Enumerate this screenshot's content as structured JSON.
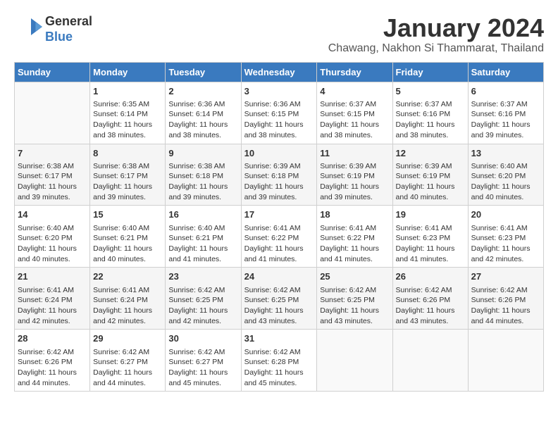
{
  "header": {
    "logo_line1": "General",
    "logo_line2": "Blue",
    "month_title": "January 2024",
    "subtitle": "Chawang, Nakhon Si Thammarat, Thailand"
  },
  "weekdays": [
    "Sunday",
    "Monday",
    "Tuesday",
    "Wednesday",
    "Thursday",
    "Friday",
    "Saturday"
  ],
  "weeks": [
    [
      {
        "day": "",
        "info": ""
      },
      {
        "day": "1",
        "info": "Sunrise: 6:35 AM\nSunset: 6:14 PM\nDaylight: 11 hours and 38 minutes."
      },
      {
        "day": "2",
        "info": "Sunrise: 6:36 AM\nSunset: 6:14 PM\nDaylight: 11 hours and 38 minutes."
      },
      {
        "day": "3",
        "info": "Sunrise: 6:36 AM\nSunset: 6:15 PM\nDaylight: 11 hours and 38 minutes."
      },
      {
        "day": "4",
        "info": "Sunrise: 6:37 AM\nSunset: 6:15 PM\nDaylight: 11 hours and 38 minutes."
      },
      {
        "day": "5",
        "info": "Sunrise: 6:37 AM\nSunset: 6:16 PM\nDaylight: 11 hours and 38 minutes."
      },
      {
        "day": "6",
        "info": "Sunrise: 6:37 AM\nSunset: 6:16 PM\nDaylight: 11 hours and 39 minutes."
      }
    ],
    [
      {
        "day": "7",
        "info": "Sunrise: 6:38 AM\nSunset: 6:17 PM\nDaylight: 11 hours and 39 minutes."
      },
      {
        "day": "8",
        "info": "Sunrise: 6:38 AM\nSunset: 6:17 PM\nDaylight: 11 hours and 39 minutes."
      },
      {
        "day": "9",
        "info": "Sunrise: 6:38 AM\nSunset: 6:18 PM\nDaylight: 11 hours and 39 minutes."
      },
      {
        "day": "10",
        "info": "Sunrise: 6:39 AM\nSunset: 6:18 PM\nDaylight: 11 hours and 39 minutes."
      },
      {
        "day": "11",
        "info": "Sunrise: 6:39 AM\nSunset: 6:19 PM\nDaylight: 11 hours and 39 minutes."
      },
      {
        "day": "12",
        "info": "Sunrise: 6:39 AM\nSunset: 6:19 PM\nDaylight: 11 hours and 40 minutes."
      },
      {
        "day": "13",
        "info": "Sunrise: 6:40 AM\nSunset: 6:20 PM\nDaylight: 11 hours and 40 minutes."
      }
    ],
    [
      {
        "day": "14",
        "info": "Sunrise: 6:40 AM\nSunset: 6:20 PM\nDaylight: 11 hours and 40 minutes."
      },
      {
        "day": "15",
        "info": "Sunrise: 6:40 AM\nSunset: 6:21 PM\nDaylight: 11 hours and 40 minutes."
      },
      {
        "day": "16",
        "info": "Sunrise: 6:40 AM\nSunset: 6:21 PM\nDaylight: 11 hours and 41 minutes."
      },
      {
        "day": "17",
        "info": "Sunrise: 6:41 AM\nSunset: 6:22 PM\nDaylight: 11 hours and 41 minutes."
      },
      {
        "day": "18",
        "info": "Sunrise: 6:41 AM\nSunset: 6:22 PM\nDaylight: 11 hours and 41 minutes."
      },
      {
        "day": "19",
        "info": "Sunrise: 6:41 AM\nSunset: 6:23 PM\nDaylight: 11 hours and 41 minutes."
      },
      {
        "day": "20",
        "info": "Sunrise: 6:41 AM\nSunset: 6:23 PM\nDaylight: 11 hours and 42 minutes."
      }
    ],
    [
      {
        "day": "21",
        "info": "Sunrise: 6:41 AM\nSunset: 6:24 PM\nDaylight: 11 hours and 42 minutes."
      },
      {
        "day": "22",
        "info": "Sunrise: 6:41 AM\nSunset: 6:24 PM\nDaylight: 11 hours and 42 minutes."
      },
      {
        "day": "23",
        "info": "Sunrise: 6:42 AM\nSunset: 6:25 PM\nDaylight: 11 hours and 42 minutes."
      },
      {
        "day": "24",
        "info": "Sunrise: 6:42 AM\nSunset: 6:25 PM\nDaylight: 11 hours and 43 minutes."
      },
      {
        "day": "25",
        "info": "Sunrise: 6:42 AM\nSunset: 6:25 PM\nDaylight: 11 hours and 43 minutes."
      },
      {
        "day": "26",
        "info": "Sunrise: 6:42 AM\nSunset: 6:26 PM\nDaylight: 11 hours and 43 minutes."
      },
      {
        "day": "27",
        "info": "Sunrise: 6:42 AM\nSunset: 6:26 PM\nDaylight: 11 hours and 44 minutes."
      }
    ],
    [
      {
        "day": "28",
        "info": "Sunrise: 6:42 AM\nSunset: 6:26 PM\nDaylight: 11 hours and 44 minutes."
      },
      {
        "day": "29",
        "info": "Sunrise: 6:42 AM\nSunset: 6:27 PM\nDaylight: 11 hours and 44 minutes."
      },
      {
        "day": "30",
        "info": "Sunrise: 6:42 AM\nSunset: 6:27 PM\nDaylight: 11 hours and 45 minutes."
      },
      {
        "day": "31",
        "info": "Sunrise: 6:42 AM\nSunset: 6:28 PM\nDaylight: 11 hours and 45 minutes."
      },
      {
        "day": "",
        "info": ""
      },
      {
        "day": "",
        "info": ""
      },
      {
        "day": "",
        "info": ""
      }
    ]
  ]
}
